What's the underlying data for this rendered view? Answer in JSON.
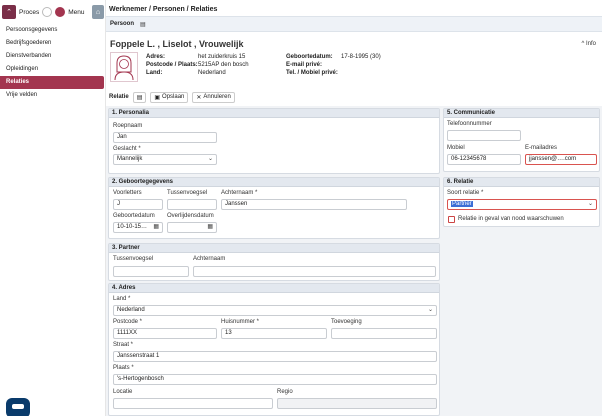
{
  "topbar": {
    "proces_label": "Proces",
    "menu_label": "Menu"
  },
  "sidebar": {
    "items": [
      {
        "label": "Persoonsgegevens",
        "active": false
      },
      {
        "label": "Bedrijfsgoederen",
        "active": false
      },
      {
        "label": "Dienstverbanden",
        "active": false
      },
      {
        "label": "Opleidingen",
        "active": false
      },
      {
        "label": "Relaties",
        "active": true
      },
      {
        "label": "Vrije velden",
        "active": false
      }
    ]
  },
  "breadcrumb": "Werknemer / Personen / Relaties",
  "persoon_label": "Persoon",
  "person": {
    "name": "Foppele L. , Liselot , Vrouwelijk",
    "info_label": "Info",
    "adres_label": "Adres:",
    "adres": "het zuiderkruis 15",
    "postcode_label": "Postcode / Plaats:",
    "postcode": "5215AP den bosch",
    "land_label": "Land:",
    "land": "Nederland",
    "geboortedatum_label": "Geboortedatum:",
    "geboortedatum": "17-8-1995 (30)",
    "email_label": "E-mail privé:",
    "tel_label": "Tel. / Mobiel privé:"
  },
  "toolbar": {
    "relatie_label": "Relatie",
    "save_label": "Opslaan",
    "cancel_label": "Annuleren"
  },
  "personalia": {
    "title": "1. Personalia",
    "roepnaam_label": "Roepnaam",
    "roepnaam": "Jan",
    "geslacht_label": "Geslacht *",
    "geslacht": "Mannelijk"
  },
  "geboorte": {
    "title": "2. Geboortegegevens",
    "voorletters_label": "Voorletters",
    "voorletters": "J",
    "tussenvoegsel_label": "Tussenvoegsel",
    "tussenvoegsel": "",
    "achternaam_label": "Achternaam *",
    "achternaam": "Janssen",
    "geboortedatum_label": "Geboortedatum",
    "geboortedatum": "10-10-15…",
    "overlijdensdatum_label": "Overlijdensdatum",
    "overlijdensdatum": ""
  },
  "partner": {
    "title": "3. Partner",
    "tussenvoegsel_label": "Tussenvoegsel",
    "achternaam_label": "Achternaam"
  },
  "adres": {
    "title": "4. Adres",
    "land_label": "Land *",
    "land": "Nederland",
    "postcode_label": "Postcode *",
    "postcode": "1111XX",
    "huisnummer_label": "Huisnummer *",
    "huisnummer": "13",
    "toevoeging_label": "Toevoeging",
    "straat_label": "Straat *",
    "straat": "Janssenstraat 1",
    "plaats_label": "Plaats *",
    "plaats": "'s-Hertogenbosch",
    "locatie_label": "Locatie",
    "regio_label": "Regio"
  },
  "communicatie": {
    "title": "5. Communicatie",
    "telefoon_label": "Telefoonnummer",
    "mobiel_label": "Mobiel",
    "mobiel": "06-12345678",
    "email_label": "E-mailadres",
    "email": "jjanssen@….com"
  },
  "relatie": {
    "title": "6. Relatie",
    "soort_label": "Soort relatie *",
    "soort": "Partner",
    "nood_label": "Relatie in geval van nood waarschuwen"
  },
  "colors": {
    "accent": "#a3354f",
    "panel_header": "#e3e8ef"
  }
}
